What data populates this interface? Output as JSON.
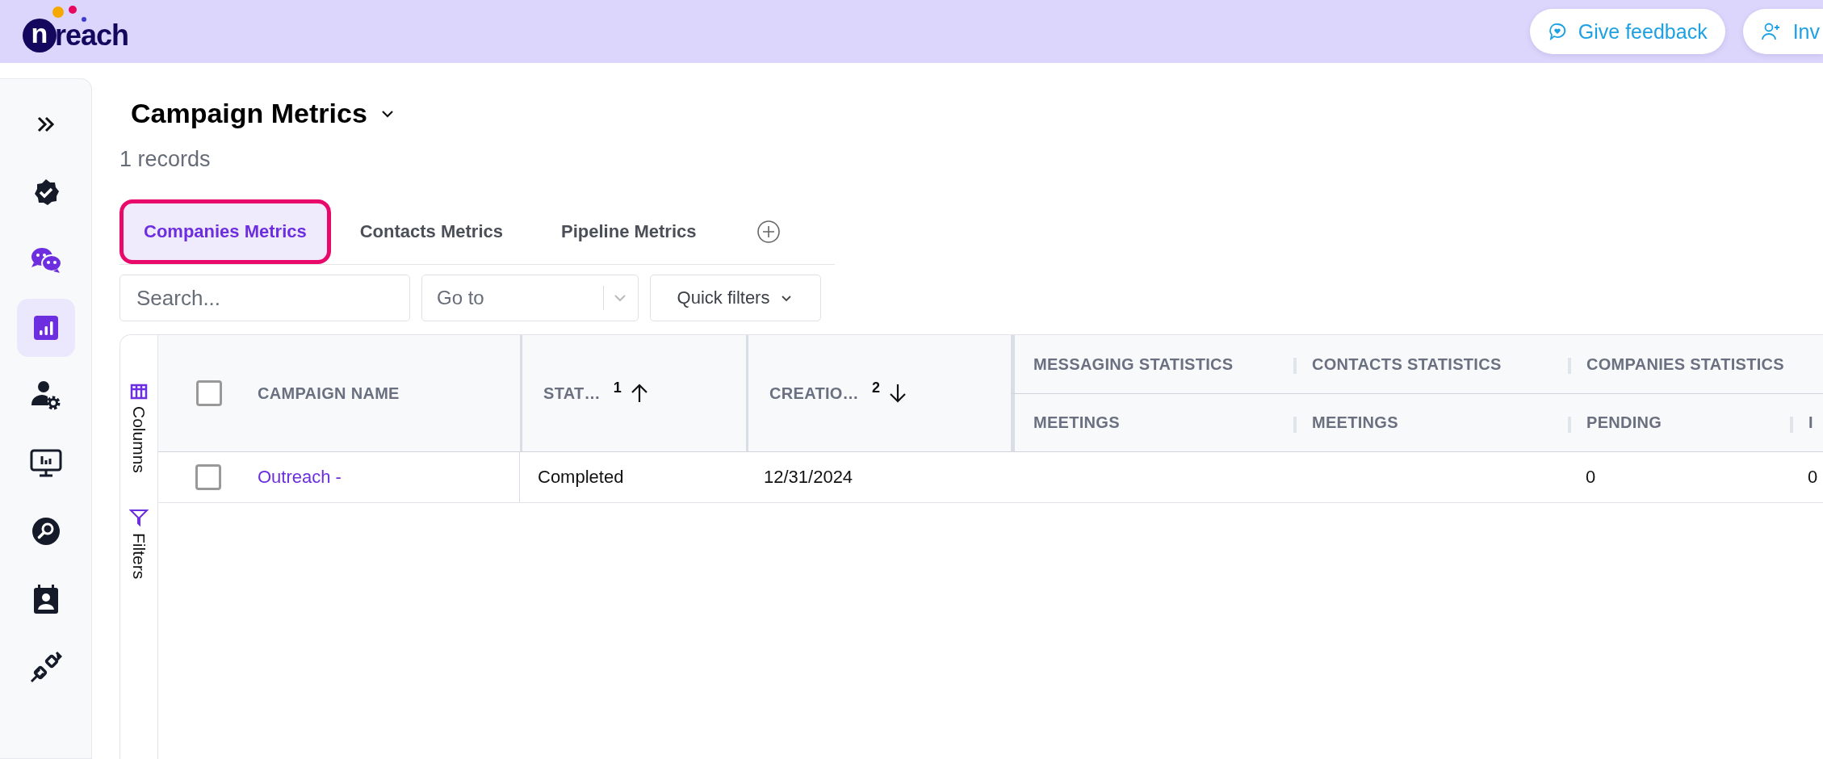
{
  "topbar": {
    "logo": {
      "mark": "n",
      "word": "reach"
    },
    "buttons": [
      {
        "kind": "feedback",
        "label": "Give feedback"
      },
      {
        "kind": "invite",
        "label": "Inv"
      }
    ]
  },
  "sidebar": {
    "items": [
      {
        "kind": "expand",
        "selected": false
      },
      {
        "kind": "badge-check",
        "selected": false
      },
      {
        "kind": "chat",
        "selected": false
      },
      {
        "kind": "chart",
        "selected": true
      },
      {
        "kind": "user-gear",
        "selected": false
      },
      {
        "kind": "monitor",
        "selected": false
      },
      {
        "kind": "search",
        "selected": false
      },
      {
        "kind": "contact",
        "selected": false
      },
      {
        "kind": "plug",
        "selected": false
      }
    ]
  },
  "page": {
    "title": "Campaign Metrics",
    "records": "1 records"
  },
  "tabs": [
    {
      "label": "Companies Metrics",
      "selected": true
    },
    {
      "label": "Contacts Metrics",
      "selected": false
    },
    {
      "label": "Pipeline Metrics",
      "selected": false
    }
  ],
  "toolbar": {
    "search": {
      "placeholder": "Search..."
    },
    "goto": {
      "placeholder": "Go to"
    },
    "quick_filters": "Quick filters"
  },
  "side_panel": [
    {
      "kind": "columns",
      "label": "Columns"
    },
    {
      "kind": "filters",
      "label": "Filters"
    }
  ],
  "table": {
    "header_checked": false,
    "columns": [
      {
        "label": "CAMPAIGN NAME"
      },
      {
        "label": "STAT…",
        "sort_order": "1",
        "ascending": true
      },
      {
        "label": "CREATIO…",
        "sort_order": "2",
        "ascending": false
      }
    ],
    "groups": [
      {
        "label": "MESSAGING STATISTICS",
        "columns": [
          "MEETINGS"
        ]
      },
      {
        "label": "CONTACTS STATISTICS",
        "columns": [
          "MEETINGS"
        ]
      },
      {
        "label": "COMPANIES STATISTICS",
        "columns": [
          "PENDING",
          "I"
        ]
      }
    ],
    "rows": [
      {
        "checked": false,
        "campaign": "Outreach -",
        "status": "Completed",
        "created": "12/31/2024",
        "pending": "0",
        "column_8": "0"
      }
    ]
  }
}
